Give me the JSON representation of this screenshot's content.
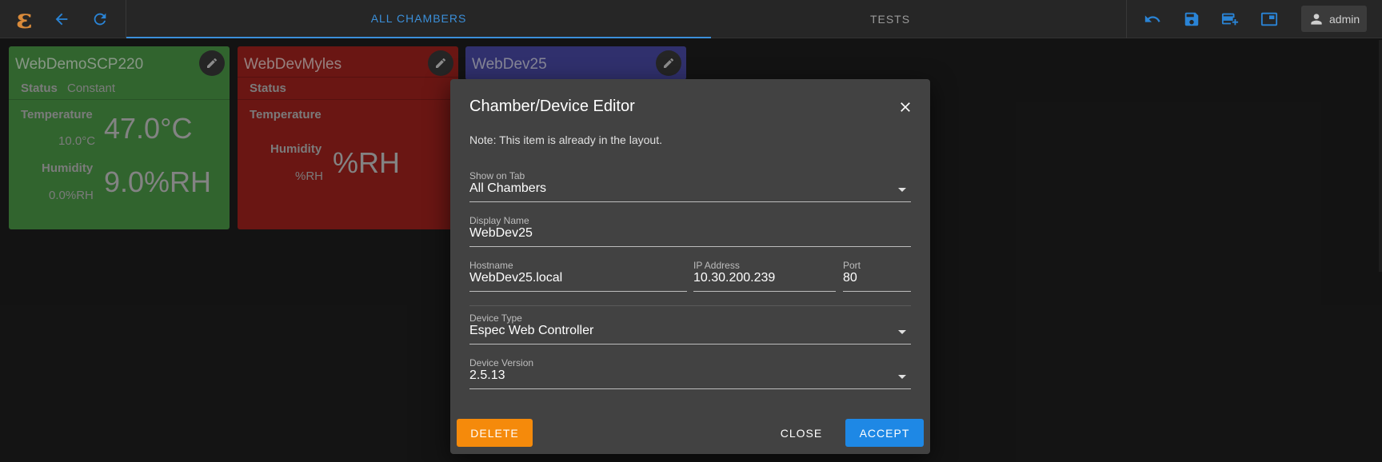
{
  "topbar": {
    "logo": "ε",
    "tabs": [
      {
        "label": "ALL CHAMBERS",
        "active": true
      },
      {
        "label": "TESTS",
        "active": false
      }
    ],
    "user": "admin",
    "accent": "#2a84d6"
  },
  "cards": [
    {
      "title": "WebDemoSCP220",
      "color": "#4c9a48",
      "status_label": "Status",
      "status_value": "Constant",
      "temp_label": "Temperature",
      "temp_setpoint": "10.0°C",
      "temp_value": "47.0°C",
      "hum_label": "Humidity",
      "hum_setpoint": "0.0%RH",
      "hum_value": "9.0%RH"
    },
    {
      "title": "WebDevMyles",
      "color": "#a3221e",
      "status_label": "Status",
      "temp_label": "Temperature",
      "hum_label": "Humidity",
      "hum_setpoint": "%RH",
      "hum_value": "%RH"
    },
    {
      "title": "WebDev25",
      "color": "#4a4aa8"
    }
  ],
  "dialog": {
    "title": "Chamber/Device Editor",
    "note": "Note: This item is already in the layout.",
    "show_on_tab": {
      "label": "Show on Tab",
      "value": "All Chambers"
    },
    "display_name": {
      "label": "Display Name",
      "value": "WebDev25"
    },
    "hostname": {
      "label": "Hostname",
      "value": "WebDev25.local"
    },
    "ip_address": {
      "label": "IP Address",
      "value": "10.30.200.239"
    },
    "port": {
      "label": "Port",
      "value": "80"
    },
    "device_type": {
      "label": "Device Type",
      "value": "Espec Web Controller"
    },
    "device_version": {
      "label": "Device Version",
      "value": "2.5.13"
    },
    "buttons": {
      "delete": "DELETE",
      "close": "CLOSE",
      "accept": "ACCEPT"
    }
  }
}
